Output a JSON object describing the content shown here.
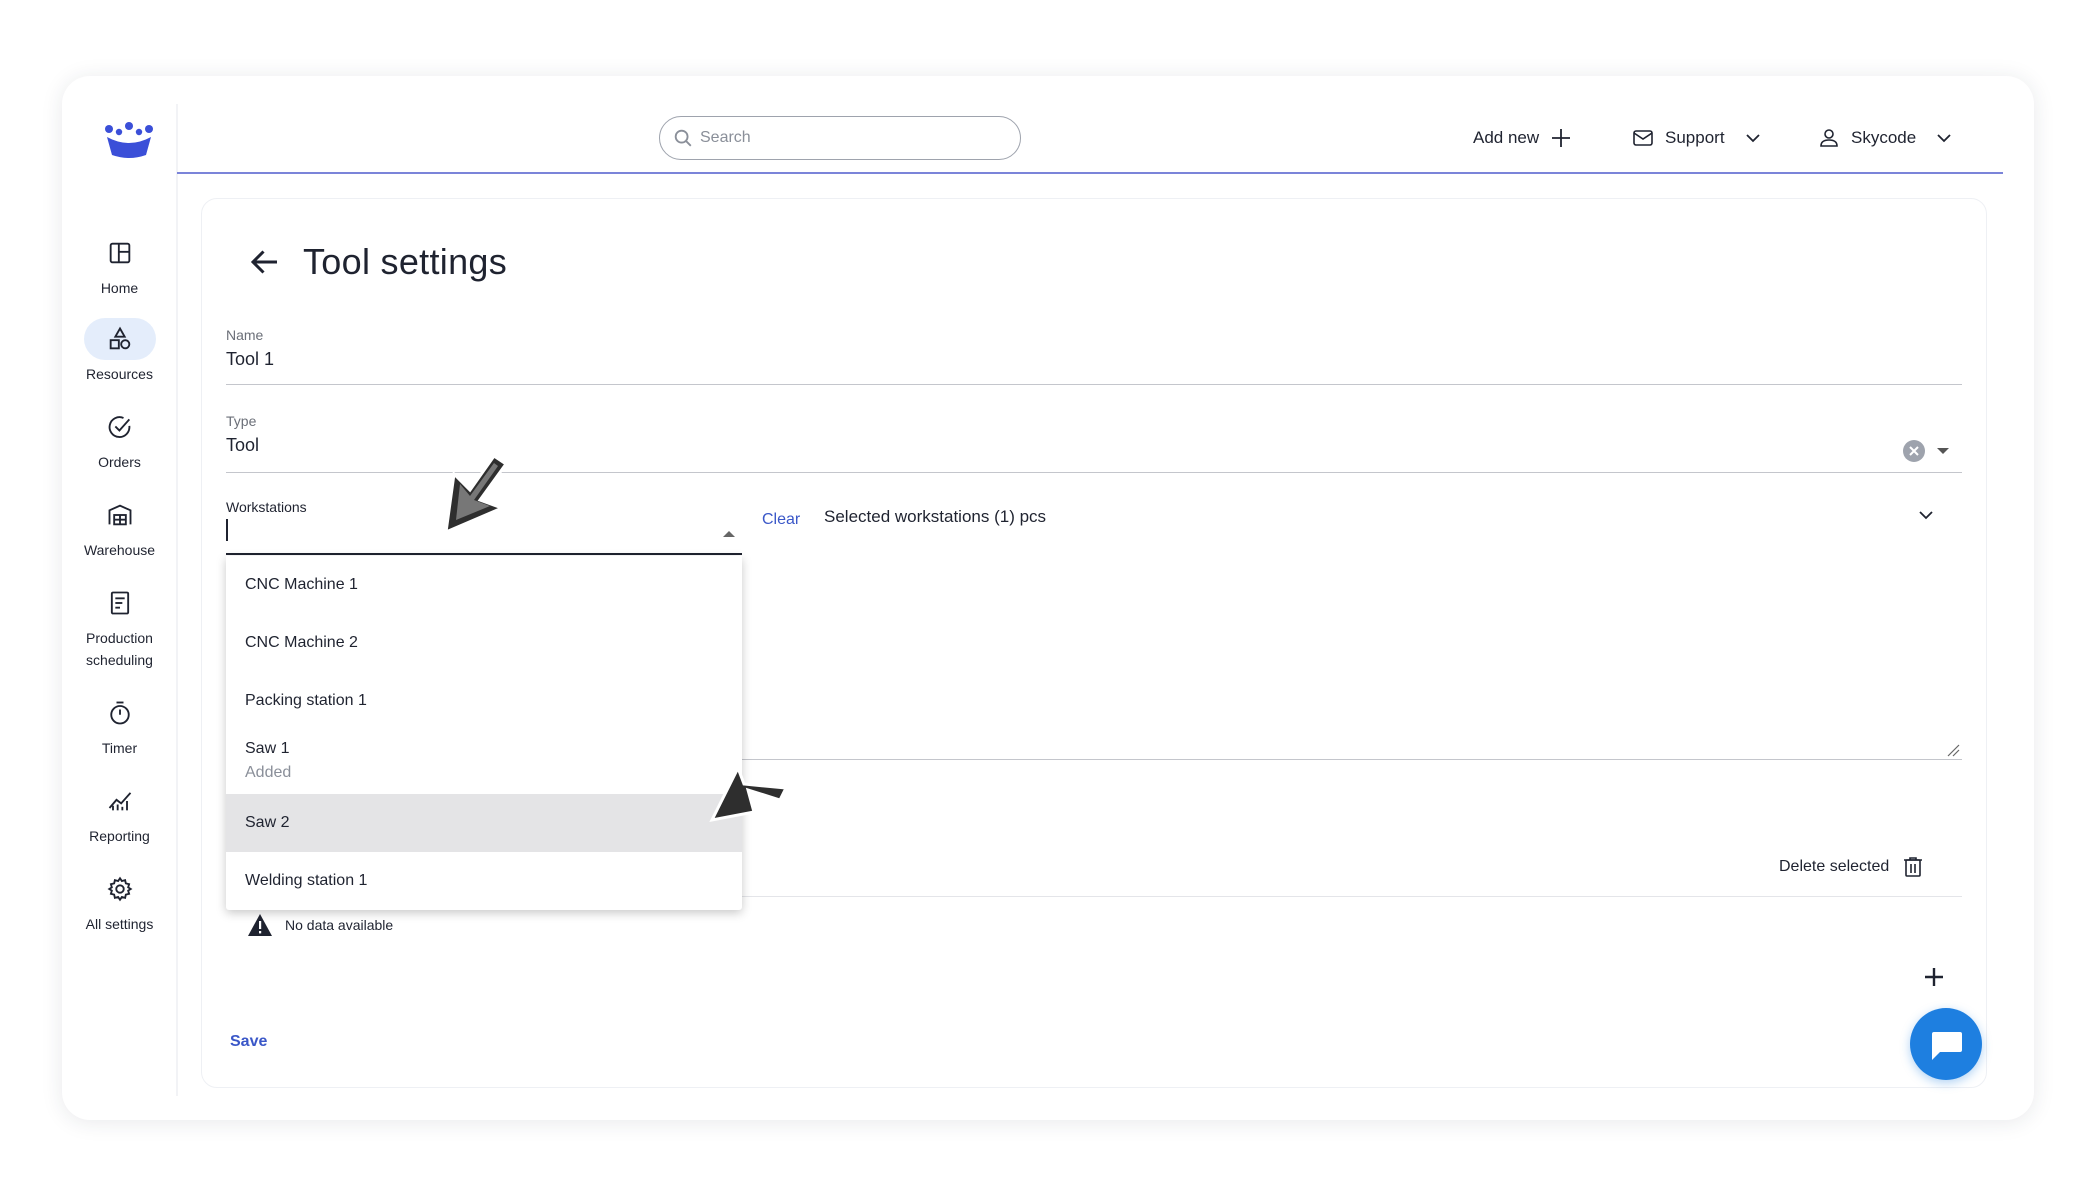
{
  "nav": {
    "items": [
      {
        "label": "Home",
        "icon": "home-icon"
      },
      {
        "label": "Resources",
        "icon": "shapes-icon",
        "active": true
      },
      {
        "label": "Orders",
        "icon": "check-circle-icon"
      },
      {
        "label": "Warehouse",
        "icon": "warehouse-icon"
      },
      {
        "label": "Production\nscheduling",
        "line1": "Production",
        "line2": "scheduling",
        "icon": "schedule-doc-icon"
      },
      {
        "label": "Timer",
        "icon": "timer-icon"
      },
      {
        "label": "Reporting",
        "icon": "chart-icon"
      },
      {
        "label": "All settings",
        "icon": "gear-icon"
      }
    ]
  },
  "topbar": {
    "search_placeholder": "Search",
    "add_new": "Add new",
    "support": "Support",
    "user": "Skycode"
  },
  "page": {
    "title": "Tool settings"
  },
  "form": {
    "name_label": "Name",
    "name_value": "Tool 1",
    "type_label": "Type",
    "type_value": "Tool",
    "workstations_label": "Workstations",
    "clear": "Clear",
    "selected_summary": "Selected workstations (1) pcs",
    "delete_selected": "Delete selected",
    "no_data": "No data available",
    "save": "Save"
  },
  "dropdown": {
    "options": [
      {
        "label": "CNC Machine 1"
      },
      {
        "label": "CNC Machine 2"
      },
      {
        "label": "Packing station 1"
      },
      {
        "label": "Saw 1",
        "sub": "Added"
      },
      {
        "label": "Saw 2",
        "highlighted": true
      },
      {
        "label": "Welding station 1"
      }
    ]
  },
  "colors": {
    "accent": "#3a57c8",
    "brand": "#3b4fd8",
    "fab": "#1e7fe0",
    "active_nav_bg": "#e4edfb"
  }
}
